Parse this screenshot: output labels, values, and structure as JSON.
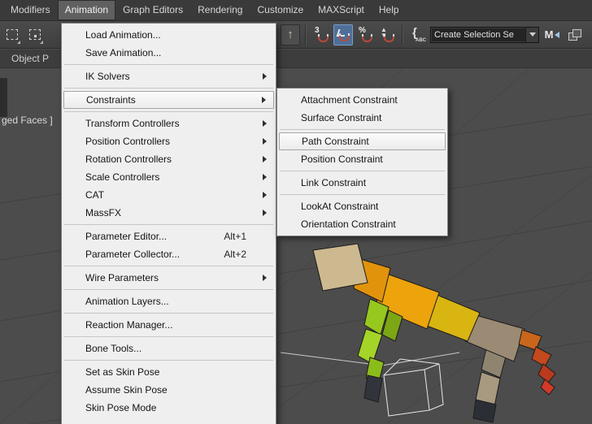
{
  "colors": {
    "menu_highlight_border": "#a6a6a6",
    "snap_active_bg": "#4f6f99",
    "viewport_bg": "#4c4c4c",
    "menubar_bg": "#3a3a3a",
    "popup_bg": "#efefef"
  },
  "menubar": {
    "items": [
      {
        "label": "Modifiers"
      },
      {
        "label": "Animation",
        "active": true
      },
      {
        "label": "Graph Editors"
      },
      {
        "label": "Rendering"
      },
      {
        "label": "Customize"
      },
      {
        "label": "MAXScript"
      },
      {
        "label": "Help"
      }
    ]
  },
  "toolbar": {
    "snap_toggle_label": "3",
    "percent_label": "%",
    "named_sets_label": "ABC",
    "selection_set_value": "Create Selection Se",
    "mirror_label": "M"
  },
  "ribbon": {
    "object_paint_tab": "Object P"
  },
  "viewport": {
    "shading_label": "ged Faces ]"
  },
  "animation_menu": {
    "items": [
      {
        "label": "Load Animation..."
      },
      {
        "label": "Save Animation..."
      },
      {
        "label": "IK Solvers",
        "submenu": true
      },
      {
        "label": "Constraints",
        "submenu": true,
        "highlighted": true
      },
      {
        "label": "Transform Controllers",
        "submenu": true
      },
      {
        "label": "Position Controllers",
        "submenu": true
      },
      {
        "label": "Rotation Controllers",
        "submenu": true
      },
      {
        "label": "Scale Controllers",
        "submenu": true
      },
      {
        "label": "CAT",
        "submenu": true
      },
      {
        "label": "MassFX",
        "submenu": true
      },
      {
        "label": "Parameter Editor...",
        "shortcut": "Alt+1"
      },
      {
        "label": "Parameter Collector...",
        "shortcut": "Alt+2"
      },
      {
        "label": "Wire Parameters",
        "submenu": true
      },
      {
        "label": "Animation Layers..."
      },
      {
        "label": "Reaction Manager..."
      },
      {
        "label": "Bone Tools..."
      },
      {
        "label": "Set as Skin Pose"
      },
      {
        "label": "Assume Skin Pose"
      },
      {
        "label": "Skin Pose Mode"
      }
    ]
  },
  "constraints_submenu": {
    "items": [
      {
        "label": "Attachment Constraint"
      },
      {
        "label": "Surface Constraint"
      },
      {
        "label": "Path Constraint",
        "highlighted": true
      },
      {
        "label": "Position Constraint"
      },
      {
        "label": "Link Constraint"
      },
      {
        "label": "LookAt Constraint"
      },
      {
        "label": "Orientation Constraint"
      }
    ]
  }
}
